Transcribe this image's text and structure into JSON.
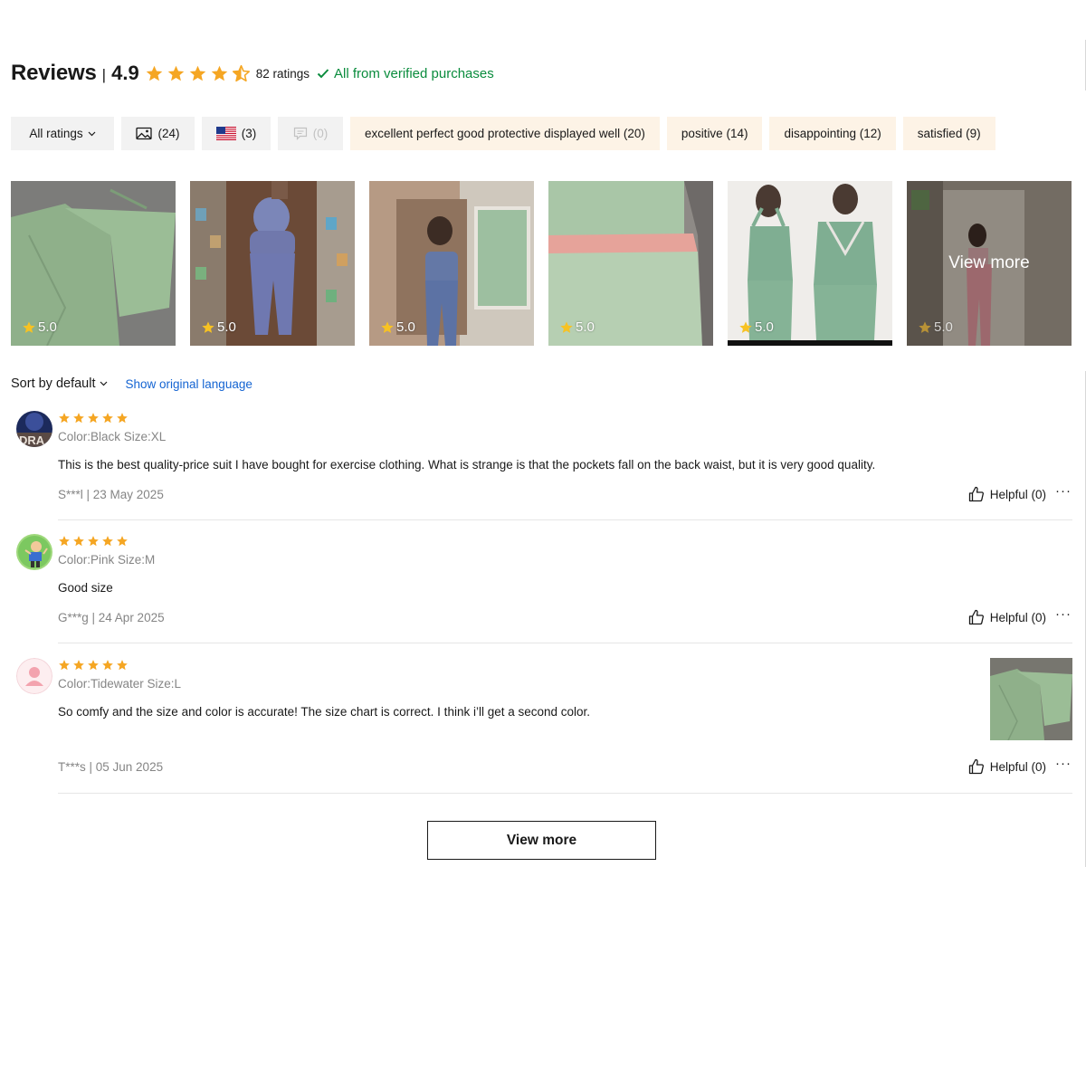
{
  "header": {
    "title": "Reviews",
    "separator": "|",
    "score": "4.9",
    "stars": 4.5,
    "ratings_count": "82 ratings",
    "verified_text": "All from verified purchases"
  },
  "filters": [
    {
      "label": "All ratings",
      "kind": "dropdown",
      "style": "grey",
      "icon": "chevron-down-icon"
    },
    {
      "label": "(24)",
      "kind": "photos",
      "style": "grey",
      "icon": "image-icon"
    },
    {
      "label": "(3)",
      "kind": "country",
      "style": "grey",
      "icon": "us-flag-icon"
    },
    {
      "label": "(0)",
      "kind": "comments",
      "style": "grey-disabled",
      "icon": "comment-icon"
    },
    {
      "label": "excellent perfect good protective displayed well (20)",
      "kind": "tag",
      "style": "tan"
    },
    {
      "label": "positive (14)",
      "kind": "tag",
      "style": "tan"
    },
    {
      "label": "disappointing (12)",
      "kind": "tag",
      "style": "tan"
    },
    {
      "label": "satisfied (9)",
      "kind": "tag",
      "style": "tan"
    }
  ],
  "thumbnails": [
    {
      "rating": "5.0",
      "subject": "green set flat lay"
    },
    {
      "rating": "5.0",
      "subject": "blue set mirror"
    },
    {
      "rating": "5.0",
      "subject": "blue set selfie"
    },
    {
      "rating": "5.0",
      "subject": "green waist closeup"
    },
    {
      "rating": "5.0",
      "subject": "green set product"
    },
    {
      "rating": "5.0",
      "subject": "pink set mirror",
      "overlay": "View more"
    }
  ],
  "sort": {
    "label": "Sort by default",
    "show_original": "Show original language"
  },
  "reviews": [
    {
      "stars": 5,
      "attributes": "Color:Black Size:XL",
      "text": "This is the best quality-price suit I have bought for exercise clothing. What is strange is that the pockets fall on the back waist, but it is very good quality.",
      "meta": "S***l | 23 May 2025",
      "helpful": "Helpful (0)",
      "more": "···",
      "avatar_text": "DRA"
    },
    {
      "stars": 5,
      "attributes": "Color:Pink Size:M",
      "text": "Good size",
      "meta": "G***g | 24 Apr 2025",
      "helpful": "Helpful (0)",
      "more": "···"
    },
    {
      "stars": 5,
      "attributes": "Color:Tidewater Size:L",
      "text": "So comfy and the size and color is accurate! The size chart is correct. I think i’ll get a second color.",
      "meta": "T***s | 05 Jun 2025",
      "helpful": "Helpful (0)",
      "more": "···",
      "has_photo": true
    }
  ],
  "view_more_button": "View more",
  "colors": {
    "star": "#f5a623",
    "verified_green": "#0a8c3d",
    "link_blue": "#1464d2",
    "chip_grey": "#f2f2f2",
    "chip_tan": "#fdf3e6"
  }
}
